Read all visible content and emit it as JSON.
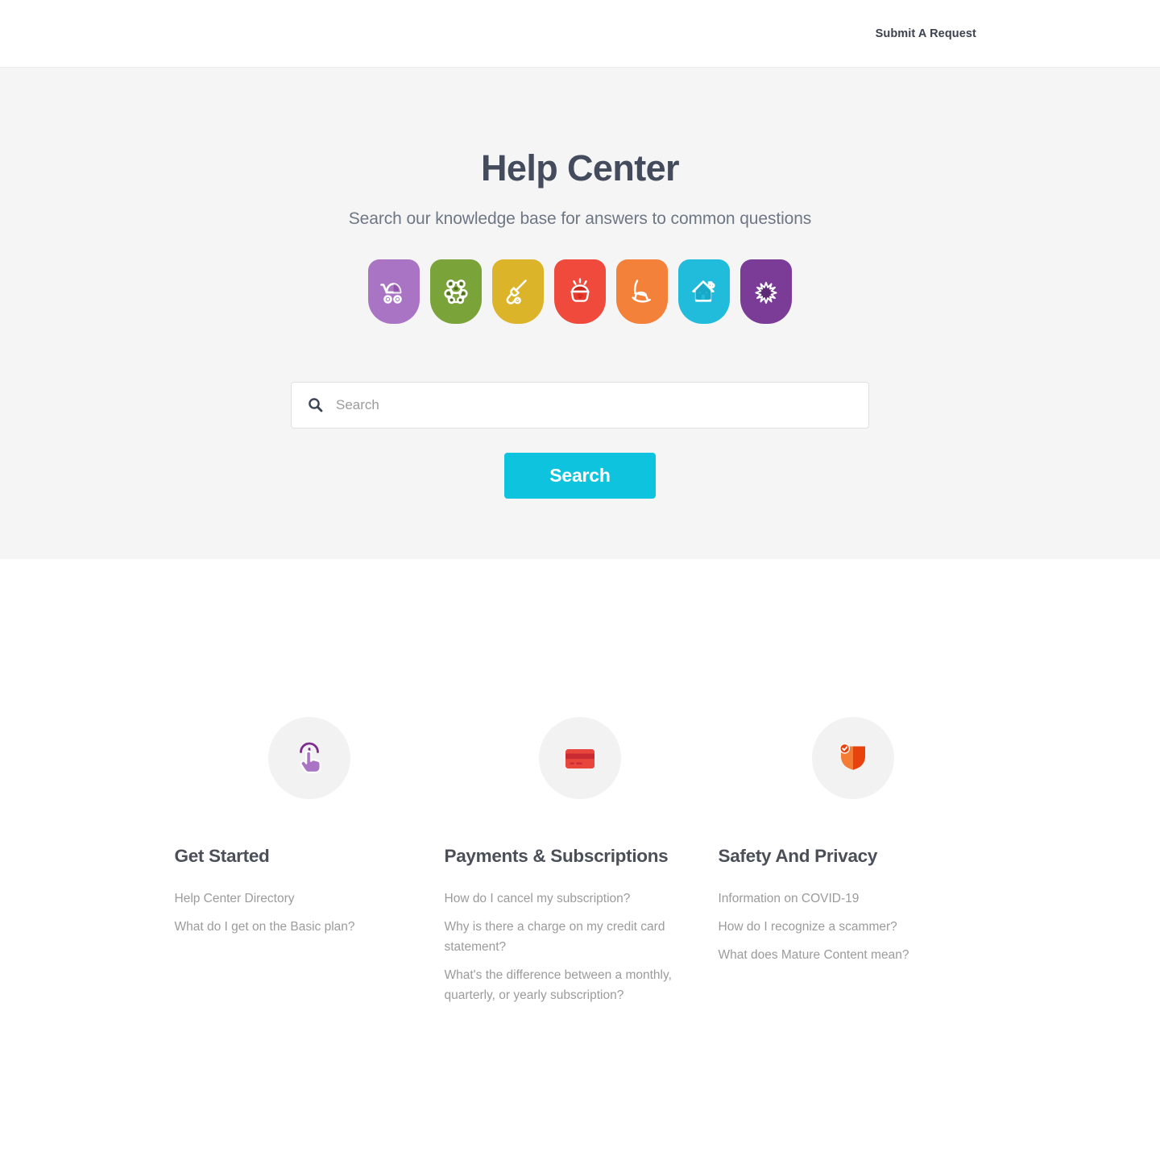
{
  "header": {
    "submit_request_label": "Submit A Request"
  },
  "hero": {
    "title": "Help Center",
    "subtitle": "Search our knowledge base for answers to common questions",
    "badges": [
      {
        "name": "stroller-badge",
        "icon": "stroller-icon",
        "color": "#a974c4"
      },
      {
        "name": "teddy-bear-badge",
        "icon": "teddy-bear-icon",
        "color": "#7aa33a"
      },
      {
        "name": "broom-badge",
        "icon": "broom-icon",
        "color": "#dcb42a"
      },
      {
        "name": "pet-bowl-badge",
        "icon": "pet-bowl-icon",
        "color": "#ef4a3c"
      },
      {
        "name": "rocking-chair-badge",
        "icon": "rocking-chair-icon",
        "color": "#f4813a"
      },
      {
        "name": "house-badge",
        "icon": "house-icon",
        "color": "#21bcdc"
      },
      {
        "name": "asterisk-badge",
        "icon": "asterisk-icon",
        "color": "#7b3c97"
      }
    ],
    "search": {
      "placeholder": "Search",
      "value": "",
      "button_label": "Search",
      "button_color": "#0ec3dd"
    }
  },
  "categories": [
    {
      "id": "get-started",
      "icon": "tap-gesture-icon",
      "title": "Get Started",
      "links": [
        "Help Center Directory",
        "What do I get on the Basic plan?"
      ]
    },
    {
      "id": "payments-subscriptions",
      "icon": "credit-card-icon",
      "title": "Payments & Subscriptions",
      "links": [
        "How do I cancel my subscription?",
        "Why is there a charge on my credit card statement?",
        "What's the difference between a monthly, quarterly, or yearly subscription?"
      ]
    },
    {
      "id": "safety-privacy",
      "icon": "shield-check-icon",
      "title": "Safety And Privacy",
      "links": [
        "Information on COVID-19",
        "How do I recognize a scammer?",
        "What does Mature Content mean?"
      ]
    }
  ],
  "theme": {
    "page_background": "#ffffff",
    "hero_background": "#f5f5f5",
    "heading_color": "#434b5c",
    "link_color": "#9b9b9b",
    "accent_color": "#0ec3dd"
  }
}
